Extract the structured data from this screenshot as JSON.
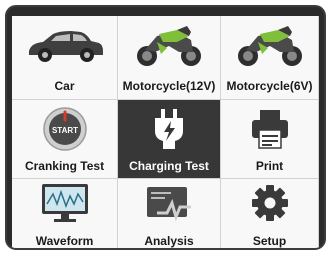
{
  "tiles": [
    {
      "label": "Car",
      "icon": "car-icon"
    },
    {
      "label": "Motorcycle(12V)",
      "icon": "motorcycle-icon"
    },
    {
      "label": "Motorcycle(6V)",
      "icon": "motorcycle-icon"
    },
    {
      "label": "Cranking Test",
      "icon": "start-button-icon",
      "badge": "START"
    },
    {
      "label": "Charging Test",
      "icon": "lightning-plug-icon",
      "selected": true
    },
    {
      "label": "Print",
      "icon": "printer-icon"
    },
    {
      "label": "Waveform",
      "icon": "monitor-waveform-icon"
    },
    {
      "label": "Analysis",
      "icon": "analysis-chart-icon"
    },
    {
      "label": "Setup",
      "icon": "gear-icon"
    }
  ],
  "colors": {
    "frame": "#2b2b2b",
    "tile": "#f8f8f8",
    "selected_tile": "#373737",
    "icon_dark": "#3a3a3a",
    "motorcycle_green": "#7fbf3a"
  }
}
